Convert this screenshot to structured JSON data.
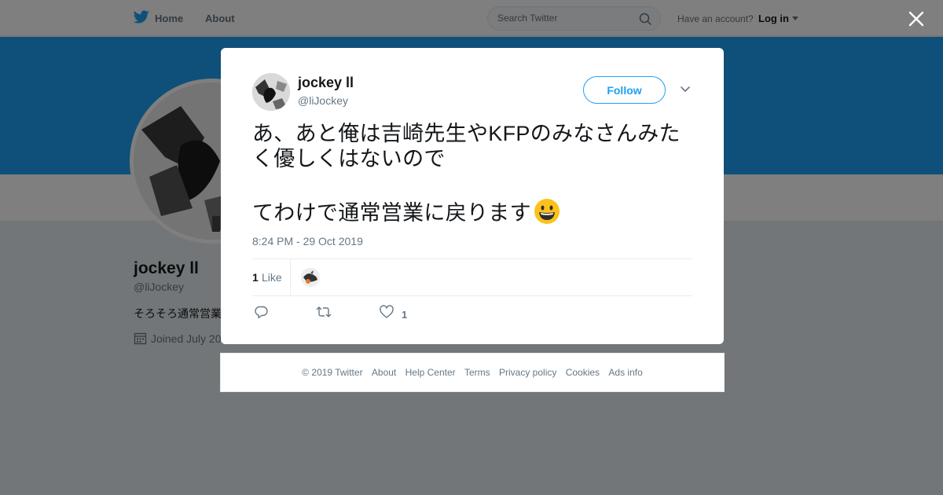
{
  "nav": {
    "home_label": "Home",
    "about_label": "About",
    "search_placeholder": "Search Twitter",
    "have_account": "Have an account?",
    "login_label": "Log in"
  },
  "profile": {
    "name": "jockey ll",
    "handle": "@liJockey",
    "bio": "そろそろ通常営業",
    "joined": "Joined July 20"
  },
  "tweet": {
    "author_name": "jockey ll",
    "author_handle": "@liJockey",
    "follow_label": "Follow",
    "text_lines": [
      "あ、あと俺は吉崎先生やKFPのみなさんみた",
      "く優しくはないので",
      "てわけで通常営業に戻ります"
    ],
    "timestamp": "8:24 PM - 29 Oct 2019",
    "likes_count": "1",
    "likes_label": "Like",
    "action_like_count": "1"
  },
  "footer": {
    "copyright": "© 2019 Twitter",
    "links": [
      "About",
      "Help Center",
      "Terms",
      "Privacy policy",
      "Cookies",
      "Ads info"
    ]
  },
  "colors": {
    "brand": "#1da1f2",
    "overlay": "rgba(0,0,0,0.5)",
    "muted_text": "#657786"
  }
}
